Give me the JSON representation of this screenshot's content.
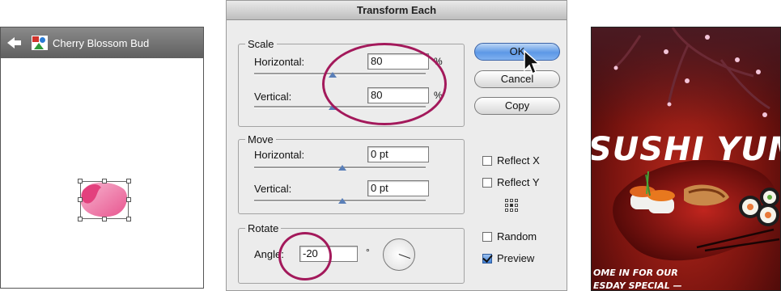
{
  "symbol_panel": {
    "title": "Cherry Blossom Bud"
  },
  "dialog": {
    "title": "Transform Each",
    "scale": {
      "legend": "Scale",
      "horizontal_label": "Horizontal:",
      "horizontal_value": "80",
      "horizontal_unit": "%",
      "vertical_label": "Vertical:",
      "vertical_value": "80",
      "vertical_unit": "%"
    },
    "move": {
      "legend": "Move",
      "horizontal_label": "Horizontal:",
      "horizontal_value": "0 pt",
      "vertical_label": "Vertical:",
      "vertical_value": "0 pt"
    },
    "rotate": {
      "legend": "Rotate",
      "angle_label": "Angle:",
      "angle_value": "-20",
      "degree_symbol": "°"
    },
    "buttons": {
      "ok": "OK",
      "cancel": "Cancel",
      "copy": "Copy"
    },
    "options": {
      "reflect_x": {
        "label": "Reflect X",
        "checked": false
      },
      "reflect_y": {
        "label": "Reflect Y",
        "checked": false
      },
      "random": {
        "label": "Random",
        "checked": false
      },
      "preview": {
        "label": "Preview",
        "checked": true
      }
    }
  },
  "poster": {
    "title": "SUSHI YUM",
    "text_lines": [
      "OME IN FOR OUR",
      "ESDAY SPECIAL —"
    ]
  },
  "colors": {
    "callout": "#a3195b",
    "blossom": "#e8558f",
    "poster_red": "#b8281c"
  }
}
